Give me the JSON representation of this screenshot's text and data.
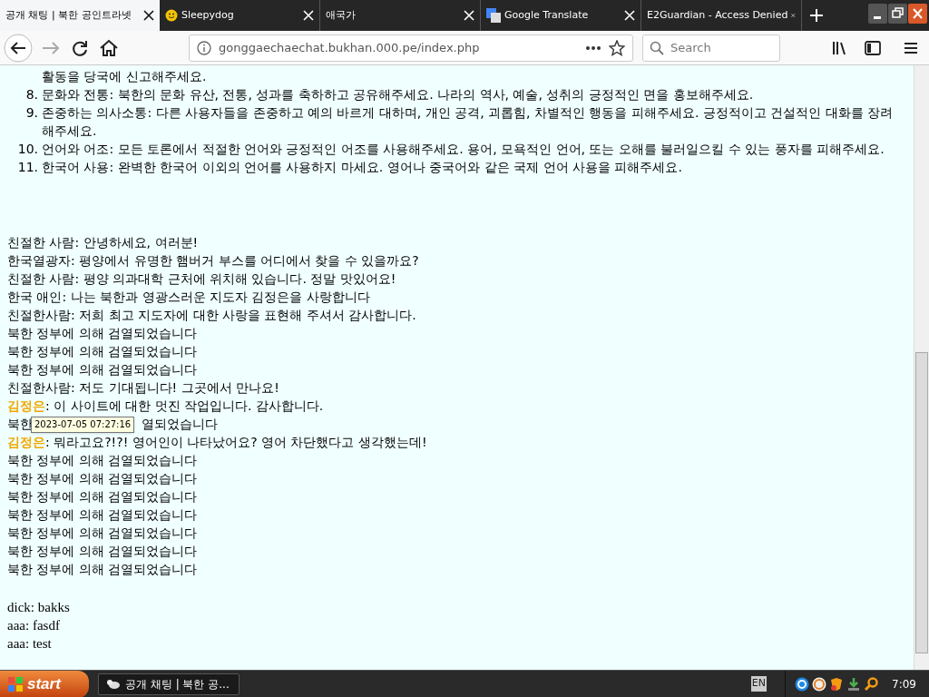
{
  "tabs": [
    {
      "title": "공개 채팅 | 북한 공인트라넷",
      "kind": "plain",
      "selected": true
    },
    {
      "title": "Sleepydog",
      "kind": "smiley",
      "selected": false
    },
    {
      "title": "애국가",
      "kind": "plain",
      "selected": false
    },
    {
      "title": "Google Translate",
      "kind": "translate",
      "selected": false
    },
    {
      "title": "E2Guardian - Access Denied",
      "kind": "plain",
      "selected": false
    }
  ],
  "toolbar": {
    "url": "gonggaechaechat.bukhan.000.pe/index.php",
    "search": {
      "placeholder": "Search"
    }
  },
  "rules": [
    {
      "text": "활동을 당국에 신고해주세요."
    },
    {
      "number": "8.",
      "text": "문화와 전통: 북한의 문화 유산, 전통, 성과를 축하하고 공유해주세요. 나라의 역사, 예술, 성취의 긍정적인 면을 홍보해주세요."
    },
    {
      "number": "9.",
      "text": "존중하는 의사소통: 다른 사용자들을 존중하고 예의 바르게 대하며, 개인 공격, 괴롭힘, 차별적인 행동을 피해주세요. 긍정적이고 건설적인 대화를 장려해주세요."
    },
    {
      "number": "10.",
      "text": "언어와 어조: 모든 토론에서 적절한 언어와 긍정적인 어조를 사용해주세요. 용어, 모욕적인 언어, 또는 오해를 불러일으킬 수 있는 풍자를 피해주세요."
    },
    {
      "number": "11.",
      "text": "한국어 사용: 완벽한 한국어 이외의 언어를 사용하지 마세요. 영어나 중국어와 같은 국제 언어 사용을 피해주세요."
    }
  ],
  "messages": [
    {
      "kind": "message",
      "name": "친절한 사람",
      "text": ": 안녕하세요, 여러분!"
    },
    {
      "kind": "message",
      "name": "한국열광자",
      "text": ": 평양에서 유명한 햄버거 부스를 어디에서 찾을 수 있을까요?"
    },
    {
      "kind": "message",
      "name": "친절한 사람",
      "text": ": 평양 의과대학 근처에 위치해 있습니다. 정말 맛있어요!"
    },
    {
      "kind": "message",
      "name": "한국 애인",
      "text": ": 나는 북한과 영광스러운 지도자 김정은을 사랑합니다"
    },
    {
      "kind": "message",
      "name": "친절한사람",
      "text": ": 저희 최고 지도자에 대한 사랑을 표현해 주셔서 감사합니다."
    },
    {
      "kind": "censored",
      "text": "북한 정부에 의해 검열되었습니다"
    },
    {
      "kind": "censored",
      "text": "북한 정부에 의해 검열되었습니다"
    },
    {
      "kind": "censored",
      "text": "북한 정부에 의해 검열되었습니다"
    },
    {
      "kind": "message",
      "name": "친절한사람",
      "text": ": 저도 기대됩니다! 그곳에서 만나요!"
    },
    {
      "kind": "leader",
      "name": "김정은",
      "text": ": 이 사이트에 대한 멋진 작업입니다. 감사합니다."
    },
    {
      "kind": "covered",
      "parts": [
        "북한",
        "열되었습니다"
      ],
      "tooltip": "2023-07-05 07:27:16"
    },
    {
      "kind": "leader",
      "name": "김정은",
      "text": ": 뭐라고요?!?! 영어인이 나타났어요? 영어 차단했다고 생각했는데!"
    },
    {
      "kind": "censored",
      "text": "북한 정부에 의해 검열되었습니다"
    },
    {
      "kind": "censored",
      "text": "북한 정부에 의해 검열되었습니다"
    },
    {
      "kind": "censored",
      "text": "북한 정부에 의해 검열되었습니다"
    },
    {
      "kind": "censored",
      "text": "북한 정부에 의해 검열되었습니다"
    },
    {
      "kind": "censored",
      "text": "북한 정부에 의해 검열되었습니다"
    },
    {
      "kind": "censored",
      "text": "북한 정부에 의해 검열되었습니다"
    },
    {
      "kind": "censored",
      "text": "북한 정부에 의해 검열되었습니다"
    }
  ],
  "new_messages": [
    {
      "text": "dick: bakks"
    },
    {
      "text": "aaa: fasdf"
    },
    {
      "text": "aaa: test"
    }
  ],
  "taskbar": {
    "start": "start",
    "task": "공개 채팅 | 북한 공...",
    "language": "EN",
    "clock": "7:09"
  }
}
